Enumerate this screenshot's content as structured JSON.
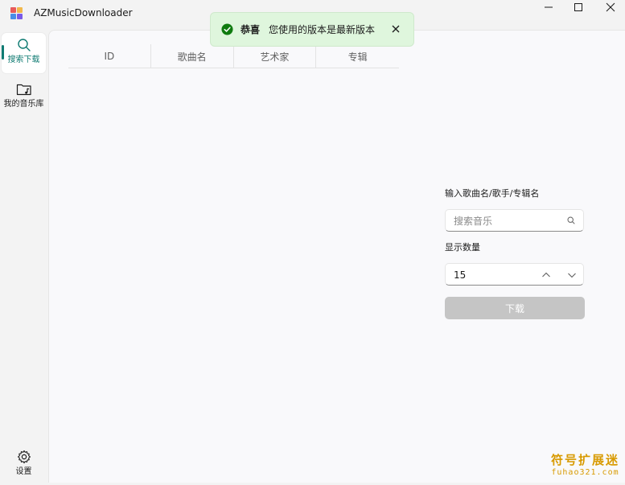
{
  "window": {
    "title": "AZMusicDownloader",
    "controls": [
      "minimize",
      "maximize",
      "close"
    ]
  },
  "sidebar": {
    "items": [
      {
        "label": "搜索下载",
        "icon": "search-icon",
        "active": true
      },
      {
        "label": "我的音乐库",
        "icon": "music-folder-icon",
        "active": false
      }
    ],
    "footer": {
      "label": "设置",
      "icon": "gear-icon"
    }
  },
  "toast": {
    "title": "恭喜",
    "message": "您使用的版本是最新版本",
    "status": "success"
  },
  "table": {
    "columns": [
      "ID",
      "歌曲名",
      "艺术家",
      "专辑"
    ],
    "rows": []
  },
  "panel": {
    "search_label": "输入歌曲名/歌手/专辑名",
    "search_placeholder": "搜索音乐",
    "count_label": "显示数量",
    "count_value": "15",
    "download_label": "下载"
  },
  "watermark": {
    "top": "符号扩展迷",
    "bottom": "fuhao321.com"
  },
  "colors": {
    "accent": "#0f7b72",
    "success_bg": "#dff6dd",
    "success_icon": "#0f7b0f",
    "disabled_button": "#c5c5c5",
    "watermark": "#d89a00"
  }
}
